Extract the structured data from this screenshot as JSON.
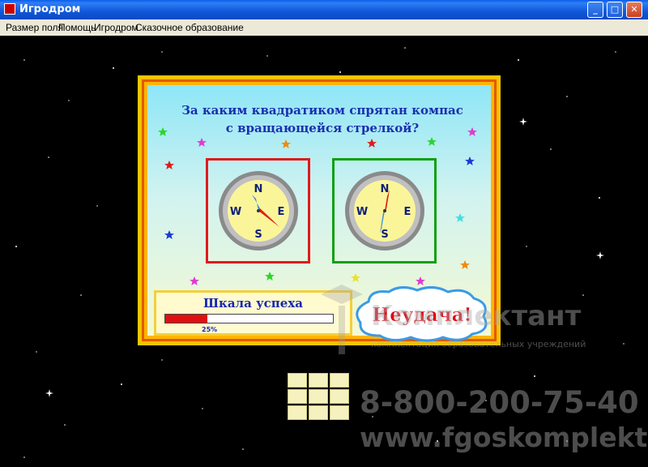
{
  "window": {
    "title": "Игродром",
    "minimize_glyph": "_",
    "maximize_glyph": "□",
    "close_glyph": "✕"
  },
  "menu": {
    "items": [
      "Размер поля",
      "Помощь",
      "Игродром",
      "Сказочное образование"
    ]
  },
  "game": {
    "question_line1": "За каким квадратиком спрятан компас",
    "question_line2": "с вращающейся стрелкой?",
    "left_compass": {
      "n": "N",
      "e": "E",
      "s": "S",
      "w": "W",
      "frame_color": "#e01a1a"
    },
    "right_compass": {
      "n": "N",
      "e": "E",
      "s": "S",
      "w": "W",
      "frame_color": "#10a010"
    },
    "progress": {
      "label": "Шкала успеха",
      "value_percent": 25,
      "value_text": "25%"
    },
    "result": {
      "text": "Неудача!"
    }
  },
  "watermark": {
    "brand": "Комплектант",
    "tagline": "комплектация образовательных учреждений",
    "phone": "8-800-200-75-40",
    "site": "www.fgoskomplekt.ru"
  },
  "colors": {
    "background": "#000000",
    "board_border": "#f3c500",
    "board_outline": "#e25a00",
    "question_text": "#1a2fb0",
    "progress_fill": "#e01010"
  }
}
